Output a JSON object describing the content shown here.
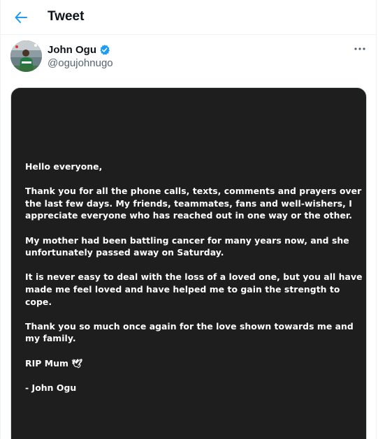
{
  "header": {
    "back_icon": "arrow-left-icon",
    "title": "Tweet"
  },
  "tweet": {
    "author": {
      "name": "John Ogu",
      "handle": "@ogujohnugo",
      "verified": true,
      "verified_icon": "verified-badge-icon",
      "avatar": "profile-photo"
    },
    "more_icon": "more-horizontal-icon",
    "image": {
      "background": "#1e1e1e",
      "paragraphs": [
        "Hello everyone,",
        "Thank you for all the phone calls, texts, comments and prayers over the last few days. My friends, teammates, fans and well-wishers, I appreciate everyone who has reached out in one way or the other.",
        "My mother had been battling cancer for many years now, and she unfortunately passed away on Saturday.",
        "It is never easy to deal with the loss of a loved one, but you all have made me feel loved and have helped me to gain the strength to cope.",
        "Thank you so much once again for the love shown towards me and my family.",
        "RIP Mum 🕊",
        "- John Ogu"
      ]
    }
  },
  "colors": {
    "accent": "#1d9bf0",
    "text_primary": "#0f1419",
    "text_secondary": "#536471"
  }
}
